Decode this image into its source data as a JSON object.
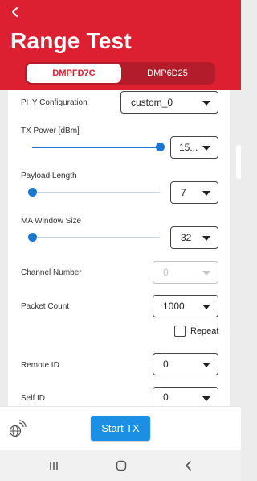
{
  "header": {
    "title": "Range Test",
    "tabs": [
      {
        "label": "DMPFD7C",
        "active": true
      },
      {
        "label": "DMP6D25",
        "active": false
      }
    ]
  },
  "form": {
    "phy_configuration": {
      "label": "PHY Configuration",
      "value": "custom_0"
    },
    "tx_power": {
      "label": "TX Power [dBm]",
      "value": "15...",
      "slider_fraction": 1.0
    },
    "payload_length": {
      "label": "Payload Length",
      "value": "7",
      "slider_fraction": 0.0
    },
    "ma_window_size": {
      "label": "MA Window Size",
      "value": "32",
      "slider_fraction": 0.0
    },
    "channel_number": {
      "label": "Channel Number",
      "value": "0",
      "disabled": true
    },
    "packet_count": {
      "label": "Packet Count",
      "value": "1000"
    },
    "repeat": {
      "label": "Repeat",
      "checked": false
    },
    "remote_id": {
      "label": "Remote ID",
      "value": "0"
    },
    "self_id": {
      "label": "Self ID",
      "value": "0"
    }
  },
  "footer": {
    "start_label": "Start TX"
  },
  "colors": {
    "brand_red": "#dc2032",
    "accent_blue": "#1976d2",
    "button_blue": "#1a8fe3"
  }
}
